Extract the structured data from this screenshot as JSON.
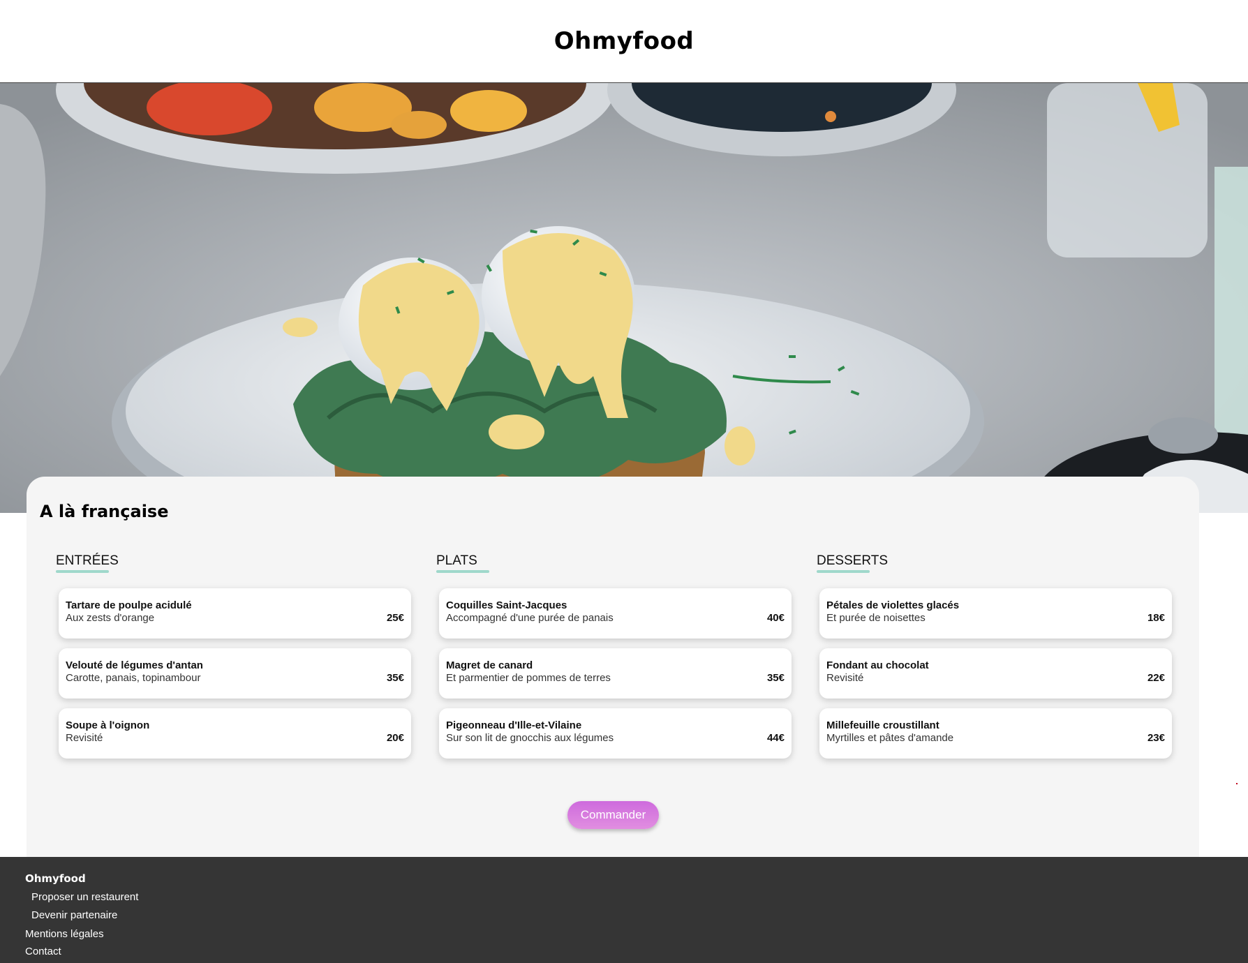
{
  "header": {
    "logo": "Ohmyfood"
  },
  "hero": {
    "image": "eggs-benedict-photo",
    "colors": {
      "plate": "#e9ecef",
      "sauce": "#f1d98a",
      "spinach": "#3f7a52",
      "bread": "#9a6a35"
    }
  },
  "menu": {
    "title": "A là française",
    "columns": [
      {
        "heading": "ENTRÉES",
        "dishes": [
          {
            "name": "Tartare de poulpe acidulé",
            "desc": "Aux zests d'orange",
            "price": "25€"
          },
          {
            "name": "Velouté de légumes d'antan",
            "desc": "Carotte, panais, topinambour",
            "price": "35€"
          },
          {
            "name": "Soupe à l'oignon",
            "desc": "Revisité",
            "price": "20€"
          }
        ]
      },
      {
        "heading": "PLATS",
        "dishes": [
          {
            "name": "Coquilles Saint-Jacques",
            "desc": "Accompagné d'une purée de panais",
            "price": "40€"
          },
          {
            "name": "Magret de canard",
            "desc": "Et parmentier de pommes de terres",
            "price": "35€"
          },
          {
            "name": "Pigeonneau d'Ille-et-Vilaine",
            "desc": "Sur son lit de gnocchis aux légumes",
            "price": "44€"
          }
        ]
      },
      {
        "heading": "DESSERTS",
        "dishes": [
          {
            "name": "Pétales de violettes glacés",
            "desc": "Et purée de noisettes",
            "price": "18€"
          },
          {
            "name": "Fondant au chocolat",
            "desc": "Revisité",
            "price": "22€"
          },
          {
            "name": "Millefeuille croustillant",
            "desc": "Myrtilles et pâtes d'amande",
            "price": "23€"
          }
        ]
      }
    ],
    "order_button": "Commander",
    "accent_color": "#9fd8cb",
    "button_color": "#d67ade"
  },
  "footer": {
    "logo": "Ohmyfood",
    "links": [
      "Proposer un restaurent",
      "Devenir partenaire",
      "Mentions légales",
      "Contact"
    ],
    "background": "#353535"
  }
}
